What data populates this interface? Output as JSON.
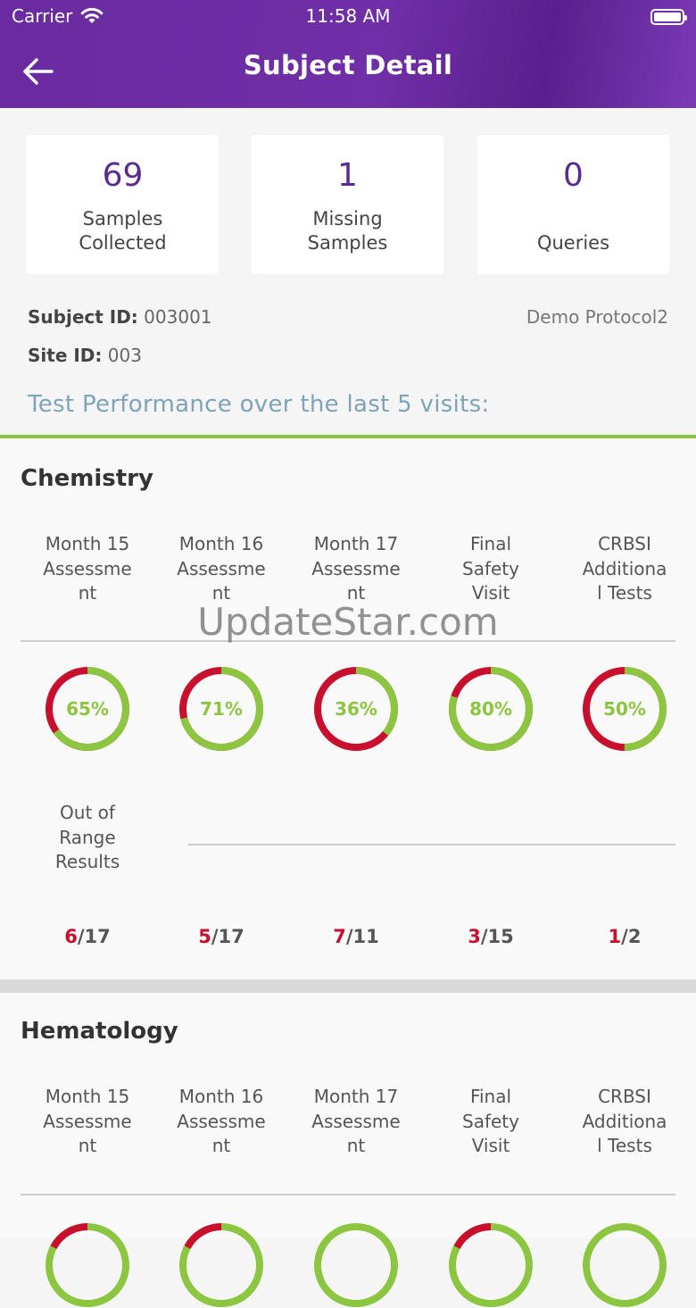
{
  "status_bar": {
    "carrier": "Carrier",
    "time": "11:58 AM"
  },
  "header": {
    "title": "Subject Detail",
    "back_icon": "back-arrow-icon"
  },
  "summary_cards": [
    {
      "value": "69",
      "label": "Samples\nCollected"
    },
    {
      "value": "1",
      "label": "Missing\nSamples"
    },
    {
      "value": "0",
      "label": "Queries"
    }
  ],
  "subject": {
    "subject_id_label": "Subject ID:",
    "subject_id": "003001",
    "site_id_label": "Site ID:",
    "site_id": "003",
    "protocol": "Demo Protocol2"
  },
  "performance_heading": "Test Performance over the last 5 visits:",
  "colors": {
    "header": "#6f2fa6",
    "good": "#8cc540",
    "bad": "#c8102e",
    "accent": "#5a2a8f"
  },
  "panels": [
    {
      "title": "Chemistry",
      "visits": [
        "Month 15\nAssessme\nnt",
        "Month 16\nAssessme\nnt",
        "Month 17\nAssessme\nnt",
        "Final\nSafety\nVisit",
        "CRBSI\nAdditiona\nl Tests"
      ],
      "percent_labels": [
        "65%",
        "71%",
        "36%",
        "80%",
        "50%"
      ],
      "percents": [
        65,
        71,
        36,
        80,
        50
      ],
      "out_of_range_label": "Out of\nRange\nResults",
      "out_of_range": [
        {
          "bad": "6",
          "total": "/17"
        },
        {
          "bad": "5",
          "total": "/17"
        },
        {
          "bad": "7",
          "total": "/11"
        },
        {
          "bad": "3",
          "total": "/15"
        },
        {
          "bad": "1",
          "total": "/2"
        }
      ]
    },
    {
      "title": "Hematology",
      "visits": [
        "Month 15\nAssessme\nnt",
        "Month 16\nAssessme\nnt",
        "Month 17\nAssessme\nnt",
        "Final\nSafety\nVisit",
        "CRBSI\nAdditiona\nl Tests"
      ]
    }
  ],
  "watermark": "UpdateStar.com"
}
